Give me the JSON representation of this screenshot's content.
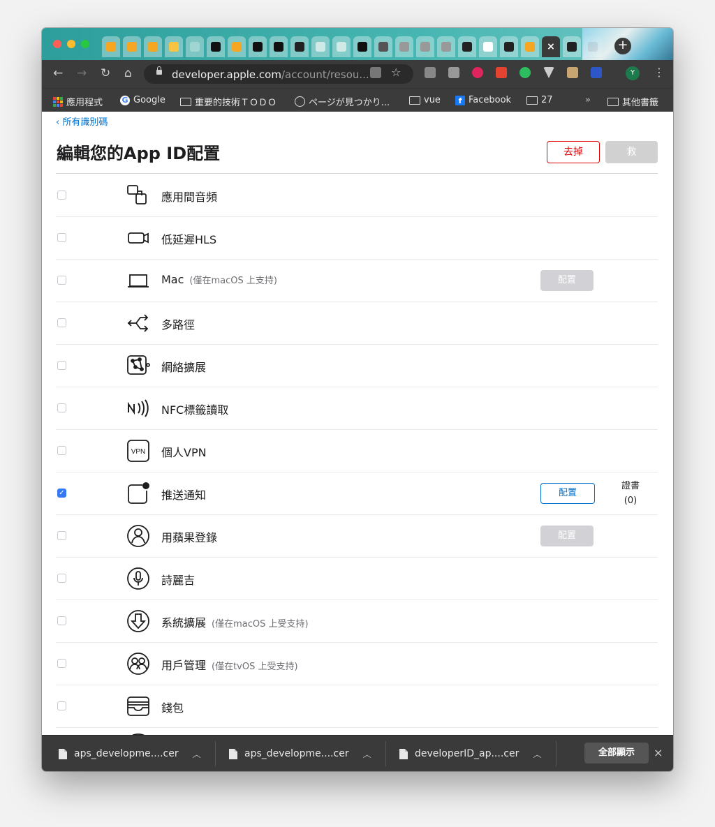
{
  "browser": {
    "url_host": "developer.apple.com",
    "url_path": "/account/resou...",
    "active_tab_close": "×",
    "new_tab": "+",
    "profile_initial": "Y"
  },
  "bookmarks": [
    {
      "label": "應用程式",
      "icon": "apps-icon"
    },
    {
      "label": "Google",
      "icon": "google-icon"
    },
    {
      "label": "重要的技術ＴＯＤＯ",
      "icon": "folder-icon"
    },
    {
      "label": "ページが見つかり...",
      "icon": "globe-icon"
    },
    {
      "label": "vue",
      "icon": "folder-icon"
    },
    {
      "label": "Facebook",
      "icon": "facebook-icon"
    },
    {
      "label": "27",
      "icon": "folder-icon"
    },
    {
      "label": "»",
      "icon": ""
    },
    {
      "label": "其他書籤",
      "icon": "folder-icon"
    }
  ],
  "page": {
    "back_link": "‹ 所有識別碼",
    "title": "編輯您的App ID配置",
    "remove_label": "去掉",
    "save_label": "救"
  },
  "capabilities": [
    {
      "label": "應用間音頻",
      "note": "",
      "icon": "inter-app-audio-icon",
      "checked": false,
      "configure": ""
    },
    {
      "label": "低延遲HLS",
      "note": "",
      "icon": "camera-icon",
      "checked": false,
      "configure": ""
    },
    {
      "label": "Mac",
      "note": "(僅在macOS 上支持)",
      "icon": "laptop-icon",
      "checked": false,
      "configure": "配置"
    },
    {
      "label": "多路徑",
      "note": "",
      "icon": "multipath-icon",
      "checked": false,
      "configure": ""
    },
    {
      "label": "網絡擴展",
      "note": "",
      "icon": "network-extension-icon",
      "checked": false,
      "configure": ""
    },
    {
      "label": "NFC標籤讀取",
      "note": "",
      "icon": "nfc-icon",
      "checked": false,
      "configure": ""
    },
    {
      "label": "個人VPN",
      "note": "",
      "icon": "vpn-icon",
      "checked": false,
      "configure": ""
    },
    {
      "label": "推送通知",
      "note": "",
      "icon": "push-notification-icon",
      "checked": true,
      "configure": "配置",
      "cert_label": "證書",
      "cert_count": "(0)"
    },
    {
      "label": "用蘋果登錄",
      "note": "",
      "icon": "sign-in-with-apple-icon",
      "checked": false,
      "configure": "配置"
    },
    {
      "label": "詩麗吉",
      "note": "",
      "icon": "siri-icon",
      "checked": false,
      "configure": ""
    },
    {
      "label": "系統擴展",
      "note": "(僅在macOS 上受支持)",
      "icon": "system-extension-icon",
      "checked": false,
      "configure": ""
    },
    {
      "label": "用戶管理",
      "note": "(僅在tvOS 上受支持)",
      "icon": "user-management-icon",
      "checked": false,
      "configure": ""
    },
    {
      "label": "錢包",
      "note": "",
      "icon": "wallet-icon",
      "checked": false,
      "configure": ""
    }
  ],
  "downloads": {
    "items": [
      "aps_developme....cer",
      "aps_developme....cer",
      "developerID_ap....cer"
    ],
    "show_all": "全部顯示",
    "close": "×"
  }
}
